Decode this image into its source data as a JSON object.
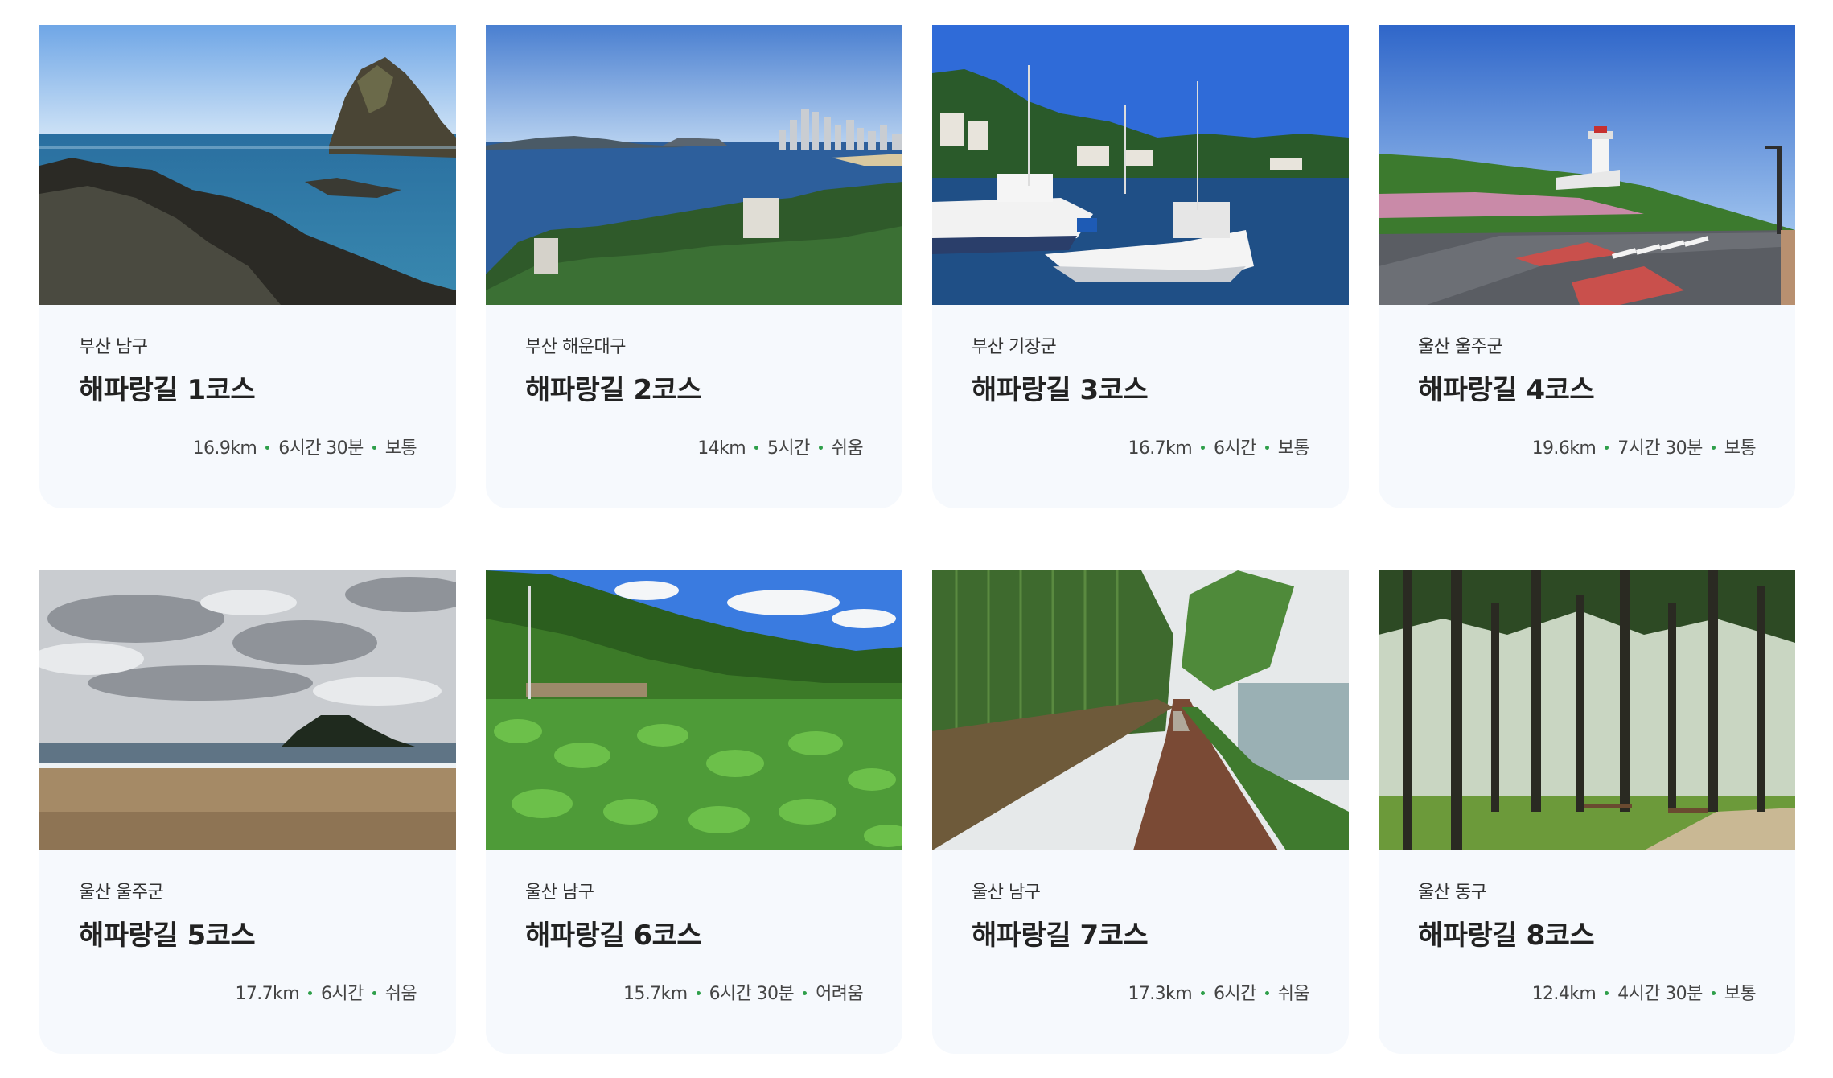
{
  "courses": [
    {
      "region": "부산 남구",
      "title": "해파랑길 1코스",
      "distance": "16.9km",
      "time": "6시간 30분",
      "difficulty": "보통",
      "photo": "rocky-coast"
    },
    {
      "region": "부산 해운대구",
      "title": "해파랑길 2코스",
      "distance": "14km",
      "time": "5시간",
      "difficulty": "쉬움",
      "photo": "bay-city"
    },
    {
      "region": "부산 기장군",
      "title": "해파랑길 3코스",
      "distance": "16.7km",
      "time": "6시간",
      "difficulty": "보통",
      "photo": "fishing-harbor"
    },
    {
      "region": "울산 울주군",
      "title": "해파랑길 4코스",
      "distance": "19.6km",
      "time": "7시간 30분",
      "difficulty": "보통",
      "photo": "lighthouse-road"
    },
    {
      "region": "울산 울주군",
      "title": "해파랑길 5코스",
      "distance": "17.7km",
      "time": "6시간",
      "difficulty": "쉬움",
      "photo": "cloudy-beach"
    },
    {
      "region": "울산 남구",
      "title": "해파랑길 6코스",
      "distance": "15.7km",
      "time": "6시간 30분",
      "difficulty": "어려움",
      "photo": "lotus-pond"
    },
    {
      "region": "울산 남구",
      "title": "해파랑길 7코스",
      "distance": "17.3km",
      "time": "6시간",
      "difficulty": "쉬움",
      "photo": "bamboo-path"
    },
    {
      "region": "울산 동구",
      "title": "해파랑길 8코스",
      "distance": "12.4km",
      "time": "4시간 30분",
      "difficulty": "보통",
      "photo": "pine-forest"
    }
  ],
  "colors": {
    "card_background": "#f6f9fd",
    "dot": "#2e9f4a",
    "title": "#222222",
    "text": "#333333"
  }
}
